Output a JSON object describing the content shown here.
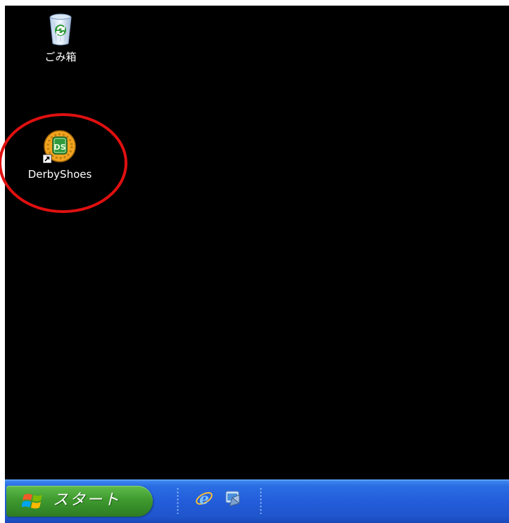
{
  "desktop": {
    "background_color": "#000000",
    "icons": [
      {
        "label": "ごみ箱",
        "icon": "recycle-bin-icon"
      },
      {
        "label": "DerbyShoes",
        "icon": "derbyshoes-app-icon",
        "badge_text": "DS",
        "shortcut": true
      }
    ],
    "highlight": {
      "target": "DerbyShoes",
      "color": "#e01010"
    }
  },
  "taskbar": {
    "start_label": "スタート",
    "start_color": "#3f9a2f",
    "bar_color": "#245edb",
    "quick_launch": [
      {
        "icon": "internet-explorer-icon"
      },
      {
        "icon": "show-desktop-icon"
      }
    ]
  }
}
